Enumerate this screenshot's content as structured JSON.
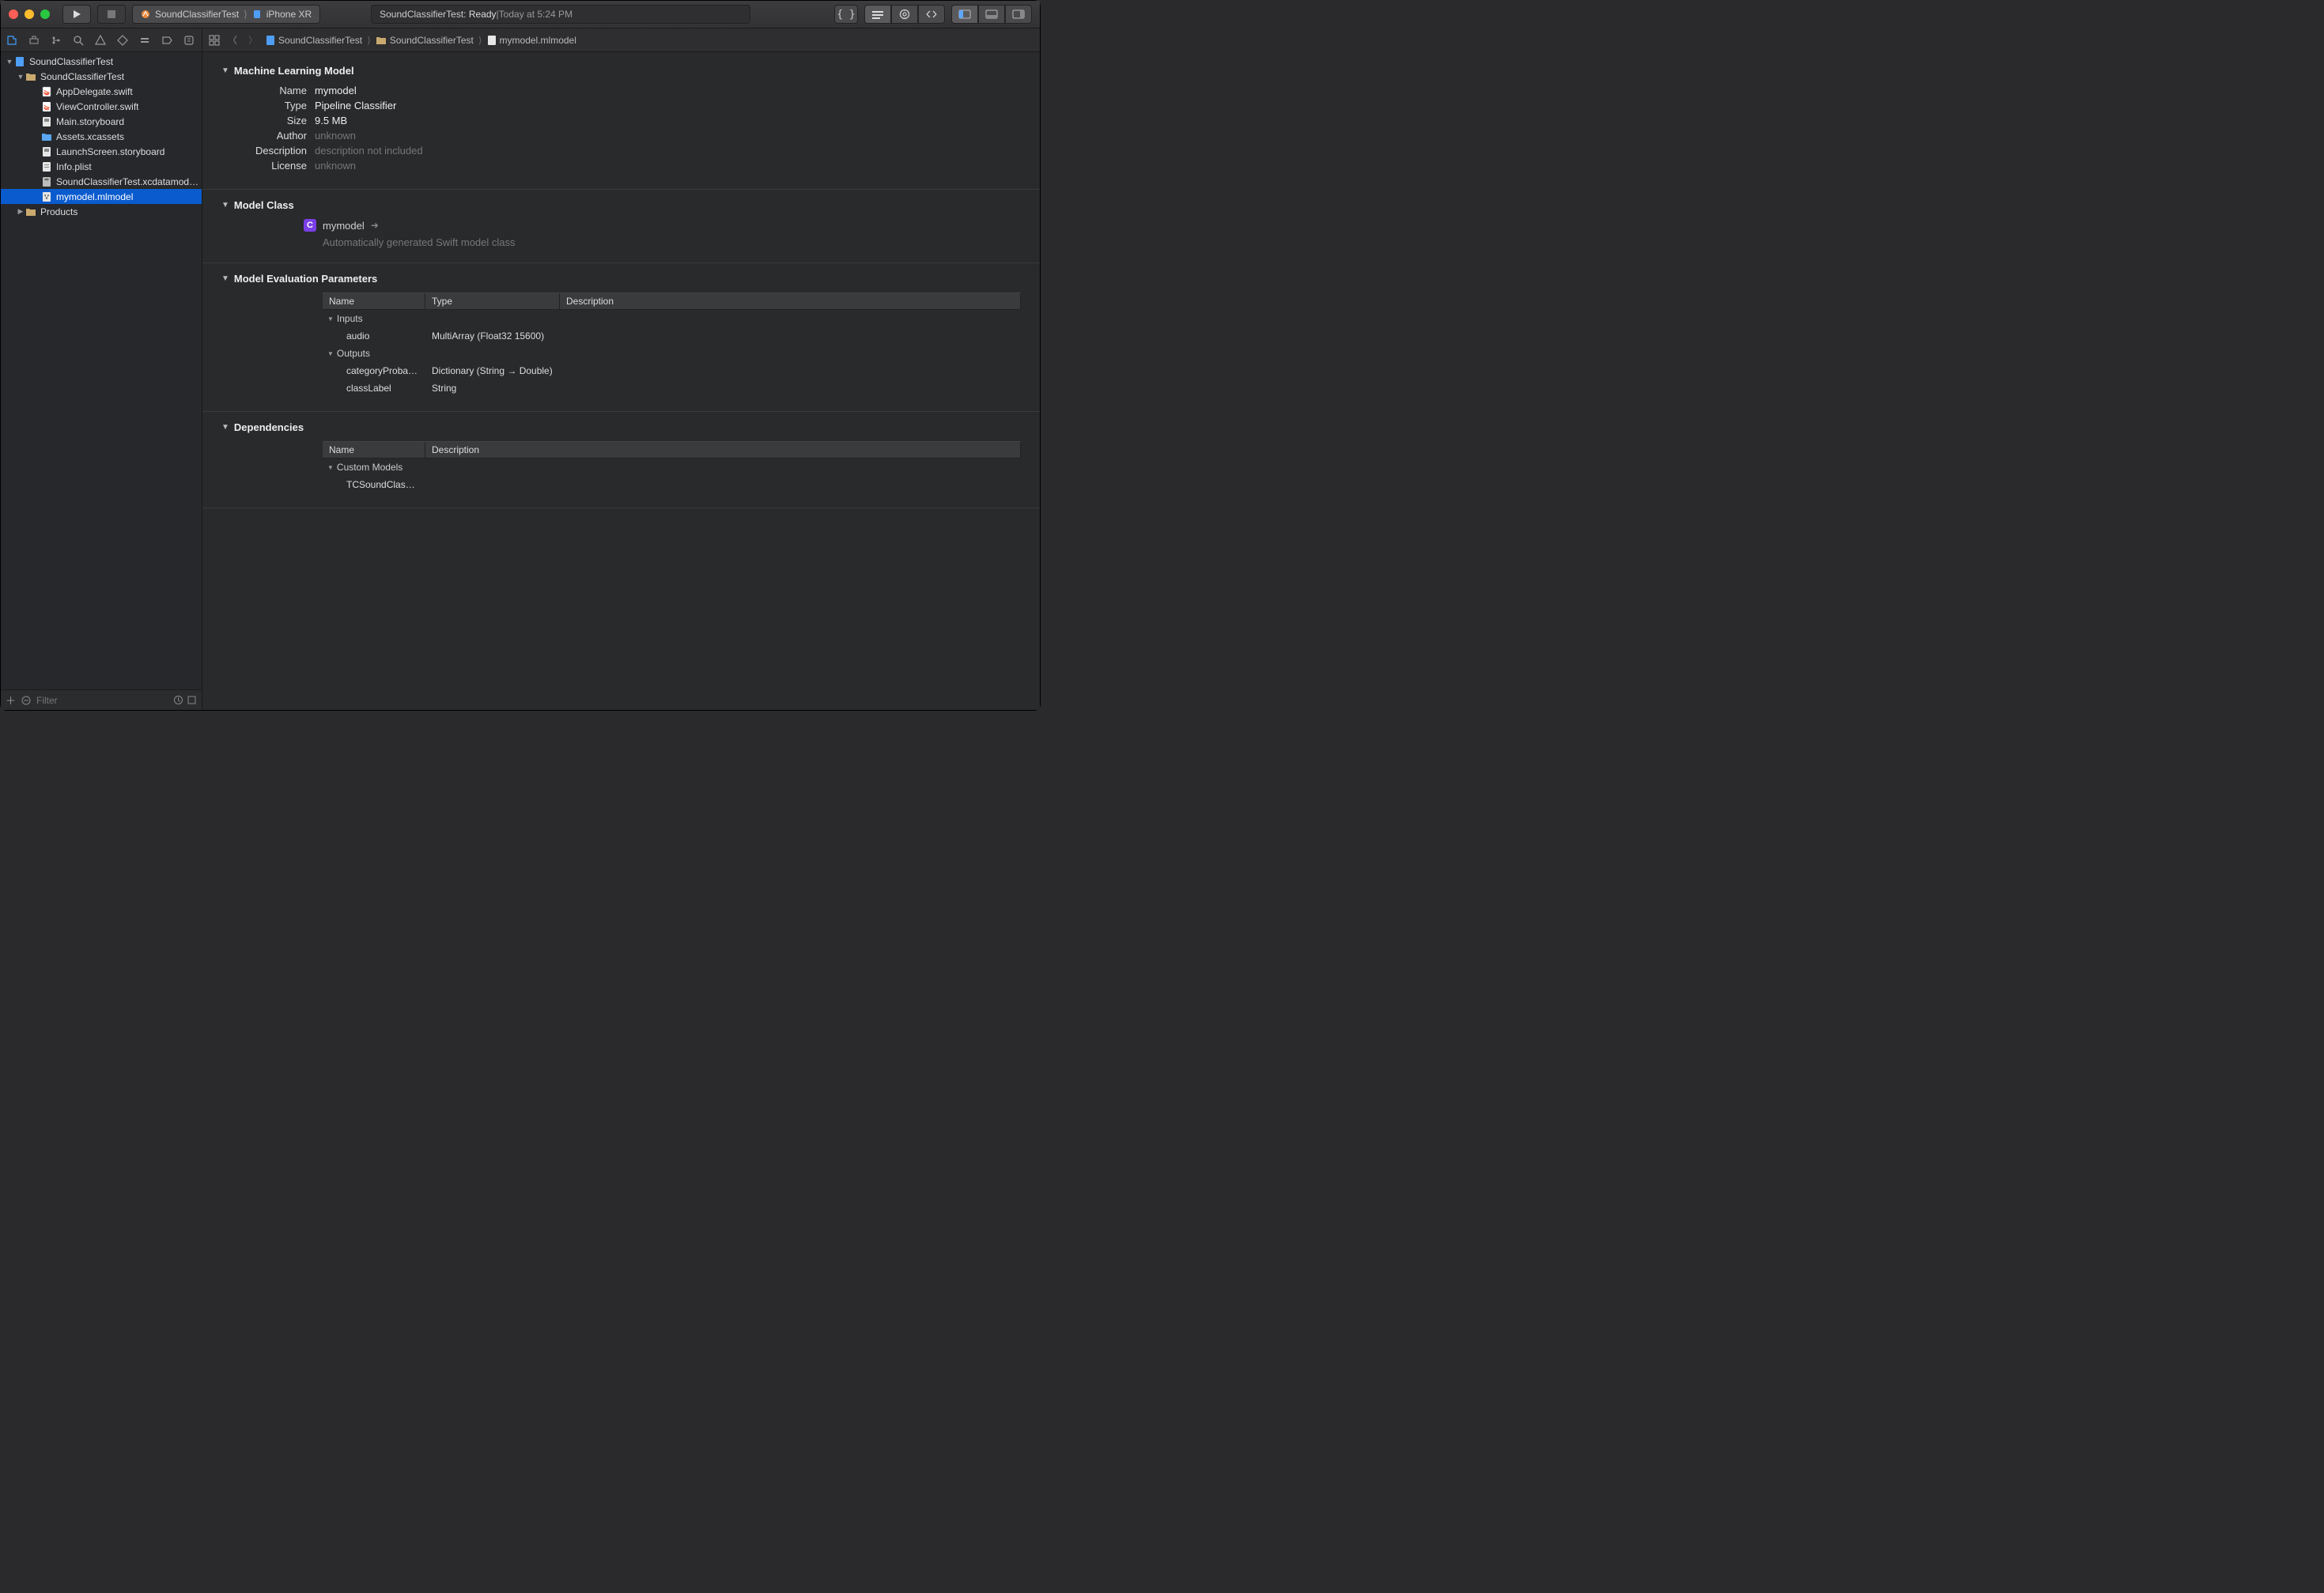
{
  "titlebar": {
    "scheme_target": "SoundClassifierTest",
    "scheme_device": "iPhone XR",
    "status_title": "SoundClassifierTest:",
    "status_state": "Ready",
    "status_sep": " | ",
    "status_time": "Today at 5:24 PM"
  },
  "sidebar": {
    "filter_placeholder": "Filter",
    "tree": {
      "root": "SoundClassifierTest",
      "group": "SoundClassifierTest",
      "files": [
        "AppDelegate.swift",
        "ViewController.swift",
        "Main.storyboard",
        "Assets.xcassets",
        "LaunchScreen.storyboard",
        "Info.plist",
        "SoundClassifierTest.xcdatamodeld",
        "mymodel.mlmodel"
      ],
      "products": "Products"
    }
  },
  "pathbar": {
    "crumbs": [
      "SoundClassifierTest",
      "SoundClassifierTest",
      "mymodel.mlmodel"
    ]
  },
  "sections": {
    "ml_model": {
      "title": "Machine Learning Model",
      "name_label": "Name",
      "name_value": "mymodel",
      "type_label": "Type",
      "type_value": "Pipeline Classifier",
      "size_label": "Size",
      "size_value": "9.5 MB",
      "author_label": "Author",
      "author_value": "unknown",
      "desc_label": "Description",
      "desc_value": "description not included",
      "license_label": "License",
      "license_value": "unknown"
    },
    "model_class": {
      "title": "Model Class",
      "class_name": "mymodel",
      "note": "Automatically generated Swift model class"
    },
    "eval": {
      "title": "Model Evaluation Parameters",
      "col_name": "Name",
      "col_type": "Type",
      "col_desc": "Description",
      "inputs_label": "Inputs",
      "outputs_label": "Outputs",
      "inputs": [
        {
          "name": "audio",
          "type": "MultiArray (Float32 15600)",
          "desc": ""
        }
      ],
      "outputs": [
        {
          "name": "categoryProbabil…",
          "type": "Dictionary (String → Double)",
          "desc": ""
        },
        {
          "name": "classLabel",
          "type": "String",
          "desc": ""
        }
      ]
    },
    "deps": {
      "title": "Dependencies",
      "col_name": "Name",
      "col_desc": "Description",
      "group_label": "Custom Models",
      "rows": [
        {
          "name": "TCSoundClassifi…",
          "desc": ""
        }
      ]
    }
  }
}
